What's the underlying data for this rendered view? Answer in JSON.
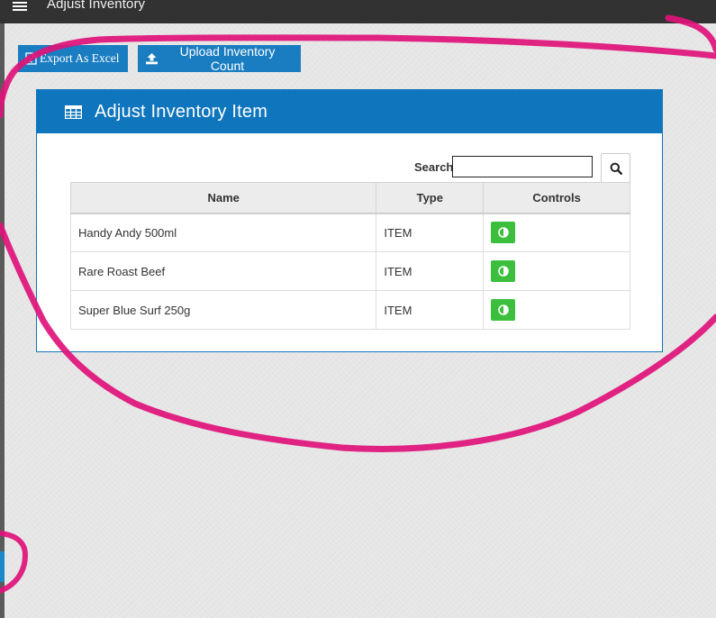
{
  "topbar": {
    "title": "Adjust Inventory",
    "menu_icon": "hamburger-menu-icon"
  },
  "toolbar": {
    "export_label": "Export As Excel",
    "export_icon": "excel-file-icon",
    "upload_label": "Upload Inventory Count",
    "upload_icon": "upload-icon"
  },
  "panel": {
    "title": "Adjust Inventory Item",
    "title_icon": "table-grid-icon"
  },
  "search": {
    "label": "Search",
    "value": "",
    "button_icon": "magnifier-icon"
  },
  "table": {
    "columns": [
      "Name",
      "Type",
      "Controls"
    ],
    "rows": [
      {
        "name": "Handy Andy 500ml",
        "type": "ITEM",
        "control_icon": "adjust-contrast-icon"
      },
      {
        "name": "Rare Roast Beef",
        "type": "ITEM",
        "control_icon": "adjust-contrast-icon"
      },
      {
        "name": "Super Blue Surf 250g",
        "type": "ITEM",
        "control_icon": "adjust-contrast-icon"
      }
    ]
  },
  "colors": {
    "brand_blue": "#0f75bc",
    "button_blue": "#1a7dc2",
    "control_green": "#3cbf3c",
    "topbar": "#323232",
    "annotation_magenta": "#e0127a"
  }
}
